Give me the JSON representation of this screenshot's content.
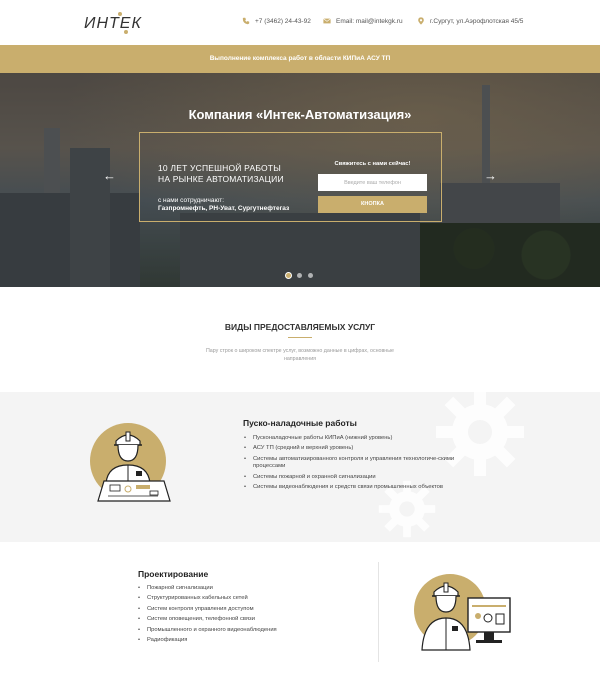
{
  "header": {
    "logo_text": "ИНТЕК",
    "phone": "+7 (3462) 24-43-92",
    "email": "Email: mail@intekgk.ru",
    "address": "г.Сургут, ул.Аэрофлотская 45/5",
    "icons": [
      "phone-icon",
      "mail-icon",
      "location-icon"
    ]
  },
  "banner": {
    "text": "Выполнение комплекса работ в области КИПиА АСУ ТП"
  },
  "hero": {
    "title": "Компания «Интек-Автоматизация»",
    "slogan_line1": "10 ЛЕТ УСПЕШНОЙ РАБОТЫ",
    "slogan_line2": "НА РЫНКЕ АВТОМАТИЗАЦИИ",
    "partners_label": "с нами сотрудничают:",
    "partners": "Газпромнефть, РН-Уват, Сургутнефтегаз",
    "form_label": "Свяжитесь с нами сейчас!",
    "phone_placeholder": "Введите ваш телефон",
    "button_label": "КНОПКА",
    "prev_arrow": "←",
    "next_arrow": "→",
    "slides_total": 3,
    "active_slide": 1
  },
  "services": {
    "title": "ВИДЫ ПРЕДОСТАВЛЯЕМЫХ УСЛУГ",
    "subtitle": "Пару строк о широком спектре услуг, возможно данные в цифрах, основные направления"
  },
  "commissioning": {
    "title": "Пуско-наладочные работы",
    "items": [
      "Пусконаладочные работы КИПиА (нижний уровень)",
      "АСУ ТП (средний и верхний уровень)",
      "Системы автоматизированного контроля и управления технологиче-скими процессами",
      "Системы пожарной и охранной сигнализации",
      "Системы видеонаблюдения и средств связи промышленных объектов"
    ]
  },
  "design": {
    "title": "Проектирование",
    "items": [
      "Пожарной сигнализации",
      "Структурированных кабельных сетей",
      "Систем контроля управления доступом",
      "Систем оповещения, телефонной связи",
      "Промышленного и охранного видеонаблюдения",
      "Радиофикация"
    ]
  },
  "colors": {
    "accent": "#c9ae6d",
    "section_bg": "#f4f4f4",
    "text": "#333333"
  }
}
